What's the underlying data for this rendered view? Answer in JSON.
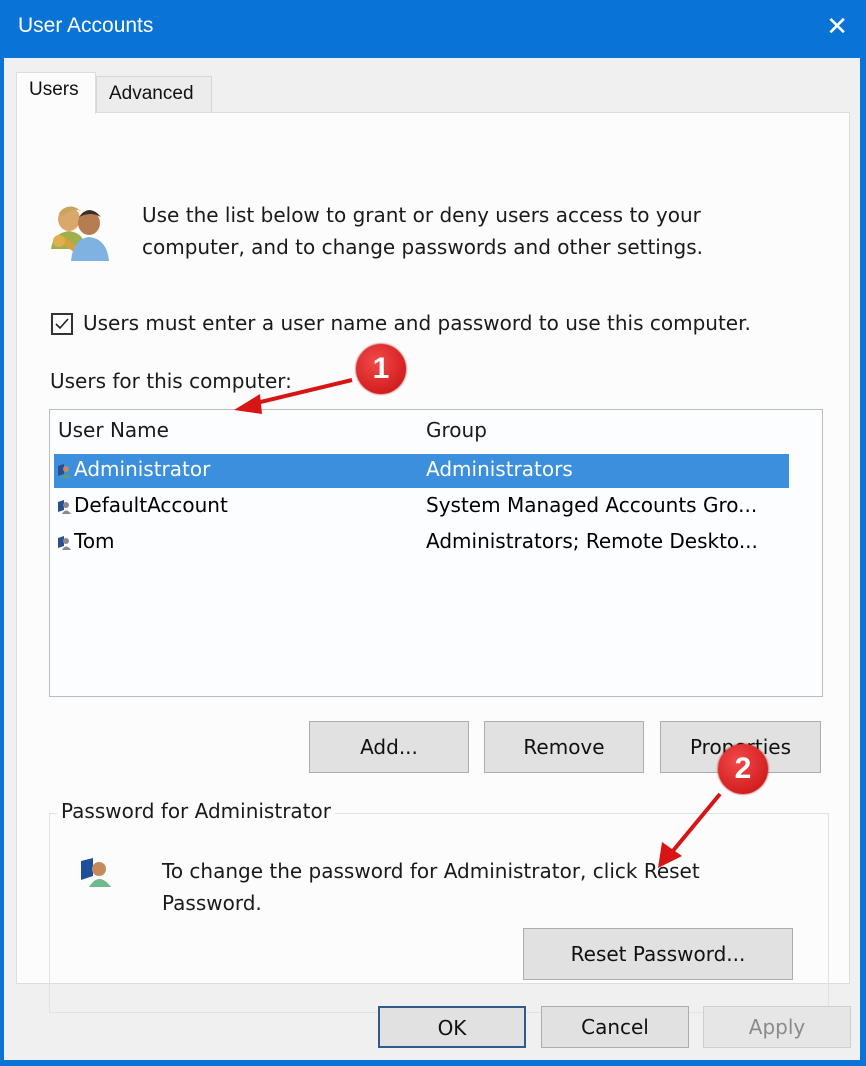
{
  "window": {
    "title": "User Accounts",
    "close_icon": "close-icon"
  },
  "tabs": [
    {
      "label": "Users",
      "active": true
    },
    {
      "label": "Advanced",
      "active": false
    }
  ],
  "intro": {
    "icon": "users-key-icon",
    "line1": "Use the list below to grant or deny users access to your",
    "line2": "computer, and to change passwords and other settings."
  },
  "require_login": {
    "checked": true,
    "label": "Users must enter a user name and password to use this computer."
  },
  "users_list": {
    "label": "Users for this computer:",
    "columns": [
      "User Name",
      "Group"
    ],
    "rows": [
      {
        "name": "Administrator",
        "group": "Administrators",
        "selected": true
      },
      {
        "name": "DefaultAccount",
        "group": "System Managed Accounts Gro...",
        "selected": false
      },
      {
        "name": "Tom",
        "group": "Administrators; Remote Deskto...",
        "selected": false
      }
    ]
  },
  "list_buttons": {
    "add": "Add...",
    "remove": "Remove",
    "properties": "Properties"
  },
  "password_group": {
    "title": "Password for Administrator",
    "line1": "To change the password for Administrator, click Reset",
    "line2": "Password.",
    "reset_button": "Reset Password..."
  },
  "dialog_buttons": {
    "ok": "OK",
    "cancel": "Cancel",
    "apply": "Apply"
  },
  "annotations": [
    {
      "number": "1",
      "target": "Administrator row"
    },
    {
      "number": "2",
      "target": "Reset Password button"
    }
  ],
  "colors": {
    "titlebar": "#0a74d6",
    "selection": "#3b8fdd",
    "badge": "#d81515"
  }
}
